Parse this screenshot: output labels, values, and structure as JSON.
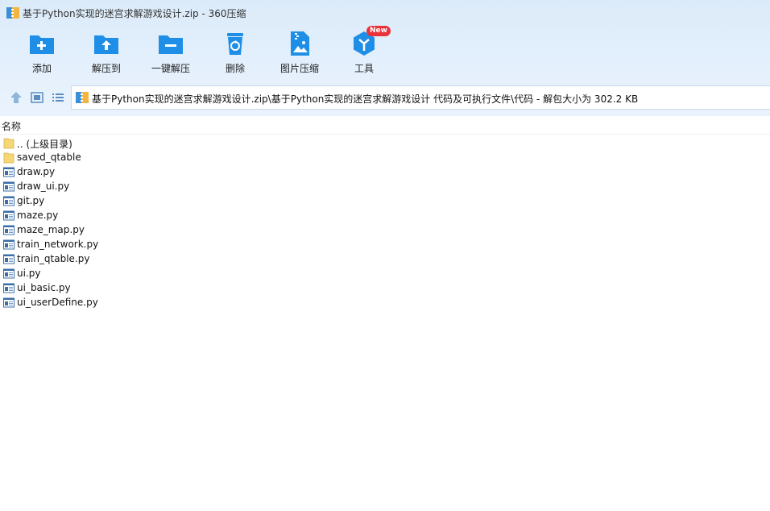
{
  "window": {
    "title": "基于Python实现的迷宫求解游戏设计.zip - 360压缩"
  },
  "toolbar": {
    "add": "添加",
    "extract_to": "解压到",
    "one_click_extract": "一键解压",
    "delete": "删除",
    "image_compress": "图片压缩",
    "tools": "工具",
    "new_badge": "New"
  },
  "address": {
    "path": "基于Python实现的迷宫求解游戏设计.zip\\基于Python实现的迷宫求解游戏设计 代码及可执行文件\\代码 - 解包大小为 302.2 KB"
  },
  "list": {
    "column_name": "名称",
    "items": [
      {
        "name": ".. (上级目录)",
        "type": "folder-up"
      },
      {
        "name": "saved_qtable",
        "type": "folder"
      },
      {
        "name": "draw.py",
        "type": "file"
      },
      {
        "name": "draw_ui.py",
        "type": "file"
      },
      {
        "name": "git.py",
        "type": "file"
      },
      {
        "name": "maze.py",
        "type": "file"
      },
      {
        "name": "maze_map.py",
        "type": "file"
      },
      {
        "name": "train_network.py",
        "type": "file"
      },
      {
        "name": "train_qtable.py",
        "type": "file"
      },
      {
        "name": "ui.py",
        "type": "file"
      },
      {
        "name": "ui_basic.py",
        "type": "file"
      },
      {
        "name": "ui_userDefine.py",
        "type": "file"
      }
    ]
  },
  "colors": {
    "accent": "#1e8ee6",
    "badge": "#e8333b",
    "folder": "#f5d776"
  }
}
